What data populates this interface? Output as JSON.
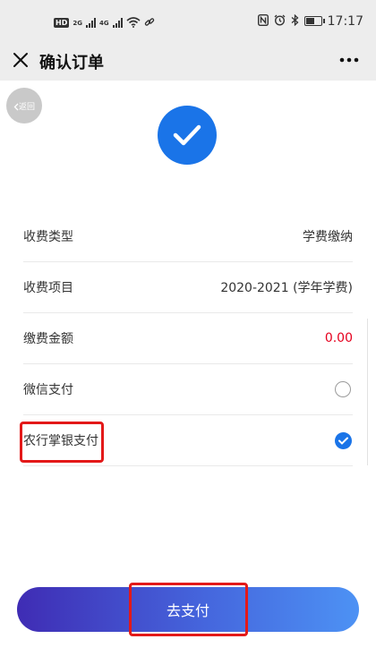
{
  "status_bar": {
    "network_badge": "HD",
    "signal_1": "2G",
    "signal_2": "4G",
    "time": "17:17"
  },
  "nav": {
    "title": "确认订单"
  },
  "content": {
    "back_label": "返回",
    "rows": [
      {
        "label": "收费类型",
        "value": "学费缴纳"
      },
      {
        "label": "收费项目",
        "value": "2020-2021 (学年学费)"
      },
      {
        "label": "缴费金额",
        "value": "0.00"
      },
      {
        "label": "微信支付",
        "selected": false
      },
      {
        "label": "农行掌银支付",
        "selected": true
      }
    ],
    "pay_button_label": "去支付"
  },
  "colors": {
    "accent_blue": "#1a74e8",
    "amount_red": "#e5001e",
    "annotation_red": "#e31919",
    "button_gradient_start": "#3f2cb4",
    "button_gradient_end": "#4d92f4"
  }
}
